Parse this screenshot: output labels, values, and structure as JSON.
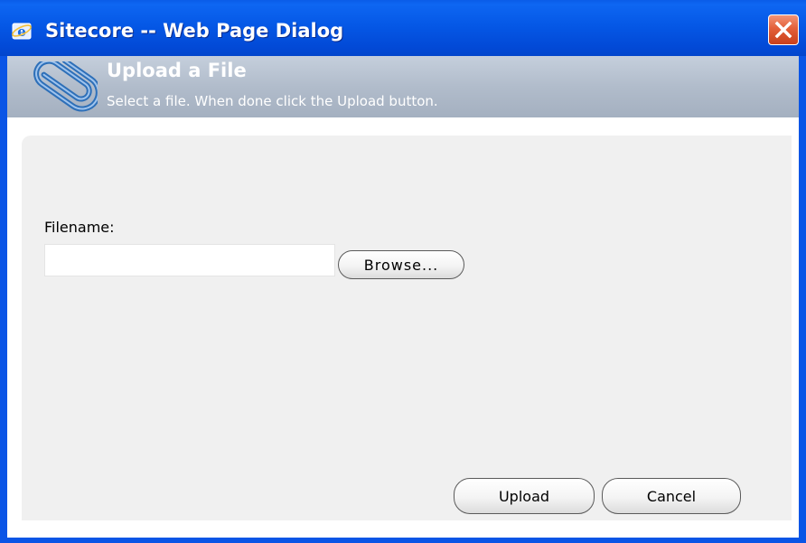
{
  "window": {
    "title": "Sitecore -- Web Page Dialog",
    "titlebar_color": "#0558e6",
    "close_color": "#e35f39"
  },
  "header": {
    "title": "Upload a File",
    "subtitle": "Select a file. When done click the Upload button.",
    "icon": "paperclip-icon"
  },
  "form": {
    "filename_label": "Filename:",
    "filename_value": "",
    "browse_label": "Browse..."
  },
  "actions": {
    "upload_label": "Upload",
    "cancel_label": "Cancel"
  }
}
